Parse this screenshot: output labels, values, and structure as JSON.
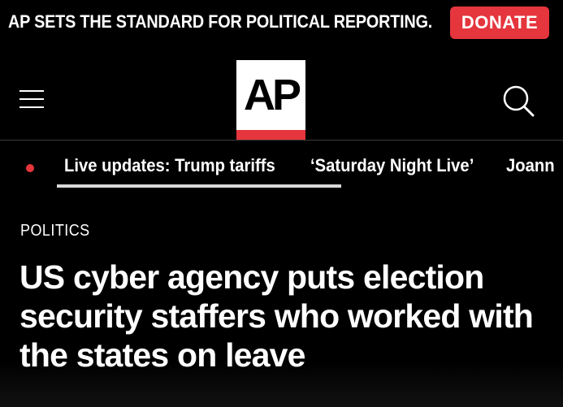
{
  "promo": {
    "text": "AP SETS THE STANDARD FOR POLITICAL REPORTING.",
    "donate_label": "DONATE"
  },
  "header": {
    "logo_text": "AP",
    "menu_icon": "hamburger-menu-icon",
    "search_icon": "search-icon"
  },
  "nav": {
    "items": [
      {
        "label": "Live updates: Trump tariffs",
        "live": true,
        "active": true
      },
      {
        "label": "‘Saturday Night Live’"
      },
      {
        "label": "Joann"
      }
    ]
  },
  "article": {
    "section": "POLITICS",
    "headline": "US cyber agency puts election security staffers who worked with the states on leave"
  },
  "colors": {
    "background": "#000000",
    "accent_red": "#e5353d",
    "text": "#ffffff",
    "active_underline": "#d9d9d9"
  }
}
